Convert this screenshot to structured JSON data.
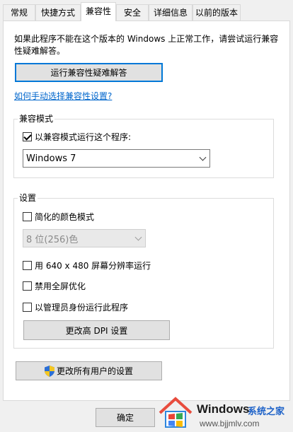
{
  "tabs": [
    {
      "label": "常规",
      "active": false
    },
    {
      "label": "快捷方式",
      "active": false
    },
    {
      "label": "兼容性",
      "active": true
    },
    {
      "label": "安全",
      "active": false
    },
    {
      "label": "详细信息",
      "active": false
    },
    {
      "label": "以前的版本",
      "active": false
    }
  ],
  "compat": {
    "description": "如果此程序不能在这个版本的 Windows 上正常工作，请尝试运行兼容性疑难解答。",
    "troubleshoot_button": "运行兼容性疑难解答",
    "manual_link": "如何手动选择兼容性设置?"
  },
  "compat_mode": {
    "group_title": "兼容模式",
    "checkbox_label": "以兼容模式运行这个程序:",
    "checked": true,
    "selected_os": "Windows 7"
  },
  "settings": {
    "group_title": "设置",
    "reduced_color_label": "简化的颜色模式",
    "reduced_color_checked": false,
    "color_select_value": "8 位(256)色",
    "res_640_label": "用 640 x 480 屏幕分辨率运行",
    "res_640_checked": false,
    "disable_fullscreen_label": "禁用全屏优化",
    "disable_fullscreen_checked": false,
    "run_as_admin_label": "以管理员身份运行此程序",
    "run_as_admin_checked": false,
    "dpi_button": "更改高 DPI 设置"
  },
  "all_users_button": "更改所有用户的设置",
  "ok_button": "确定",
  "watermark": {
    "brand": "Windows",
    "site_cn": "系统之家",
    "url": "www.bjjmlv.com"
  },
  "colors": {
    "accent": "#0078d7",
    "link": "#0066cc",
    "panel_bg": "#ffffff",
    "window_bg": "#f0f0f0"
  }
}
